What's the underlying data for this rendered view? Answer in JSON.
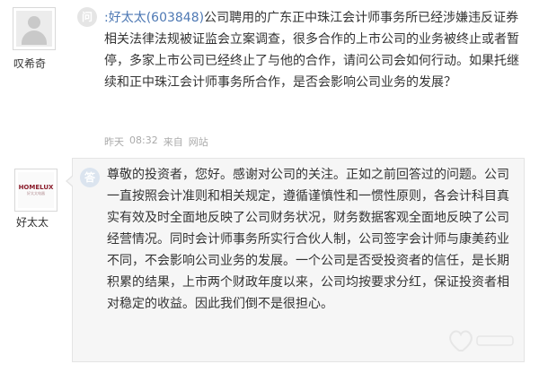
{
  "question": {
    "user_name": "叹希奇",
    "badge": "问",
    "asker": ":好太太(603848)",
    "text": "公司聘用的广东正中珠江会计师事务所已经涉嫌违反证券相关法律法规被证监会立案调查，很多合作的上市公司的业务被终止或者暂停，多家上市公司已经终止了与他的合作，请问公司会如何行动。如果托继续和正中珠江会计师事务所合作，是否会影响公司业务的发展？",
    "meta": {
      "day": "昨天",
      "time": "08:32",
      "from": "来自",
      "source": "网站"
    }
  },
  "answer": {
    "company_name": "好太太",
    "logo_text": "HOMELUX",
    "logo_subtext": "好太太电器",
    "badge": "答",
    "text": "尊敬的投资者，您好。感谢对公司的关注。正如之前回答过的问题。公司一直按照会计准则和相关规定，遵循谨慎性和一惯性原则，各会计科目真实有效及时全面地反映了公司财务状况，财务数据客观全面地反映了公司经营情况。同时会计师事务所实行合伙人制，公司签字会计师与康美药业不同，不会影响公司业务的发展。一个公司是否受投资者的信任，是长期积累的结果，上市两个财政年度以来，公司均按要求分红，保证投资者相对稳定的收益。因此我们倒不是很担心。"
  },
  "colors": {
    "link_blue": "#4e79b4",
    "answer_bg": "#f6f6f6",
    "meta_gray": "#aaaaaa"
  },
  "icons": {
    "question_avatar": "default-user-avatar",
    "answer_avatar": "company-logo",
    "watermark": "heart-watermark-icon"
  }
}
